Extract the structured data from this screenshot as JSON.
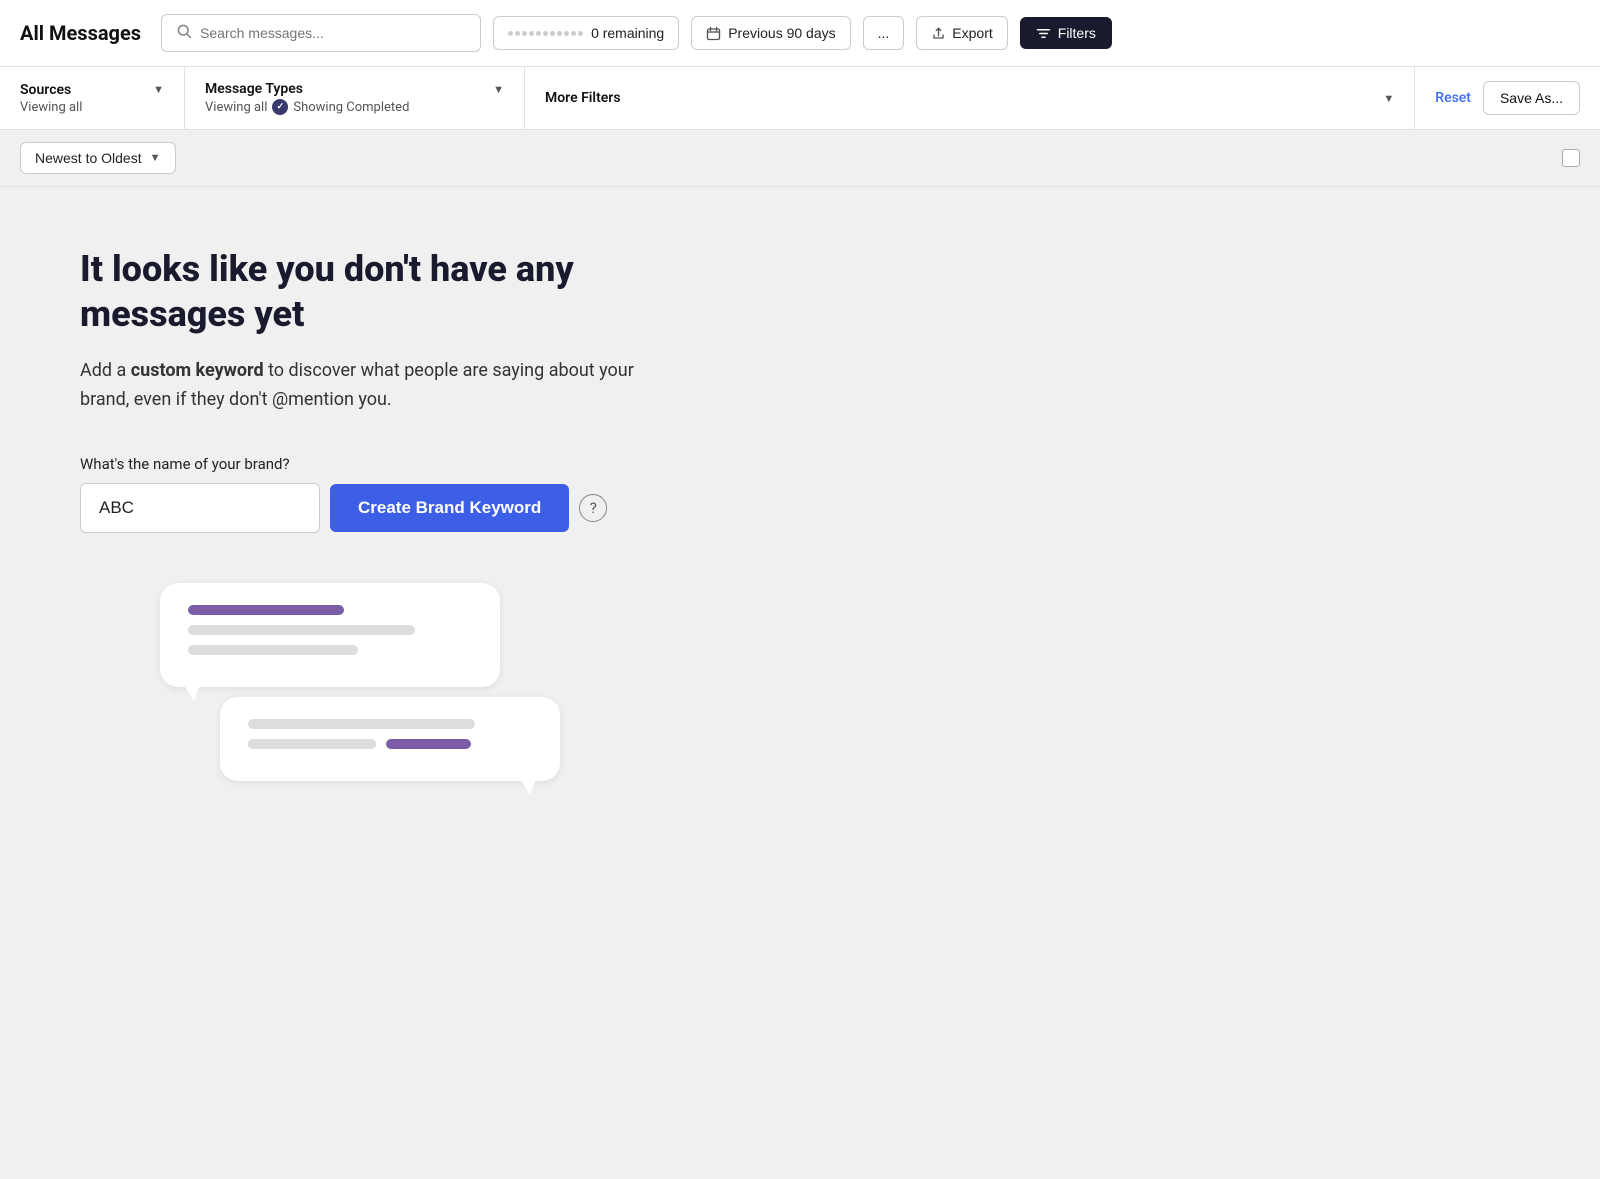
{
  "header": {
    "title": "All Messages",
    "search_placeholder": "Search messages...",
    "remaining_label": "0 remaining",
    "date_range_label": "Previous 90 days",
    "more_label": "...",
    "export_label": "Export",
    "filters_label": "Filters"
  },
  "filter_bar": {
    "sources_label": "Sources",
    "sources_sublabel": "Viewing all",
    "message_types_label": "Message Types",
    "message_types_sublabel": "Viewing all",
    "message_types_badge": "Showing Completed",
    "more_filters_label": "More Filters",
    "reset_label": "Reset",
    "save_as_label": "Save As..."
  },
  "sort_bar": {
    "sort_label": "Newest to Oldest"
  },
  "main": {
    "empty_heading": "It looks like you don't have any messages yet",
    "empty_subtext_prefix": "Add a ",
    "empty_subtext_bold": "custom keyword",
    "empty_subtext_suffix": " to discover what people are saying about your brand, even if they don't @mention you.",
    "brand_form_label": "What's the name of your brand?",
    "brand_input_value": "ABC",
    "brand_input_placeholder": "ABC",
    "create_keyword_label": "Create Brand Keyword",
    "help_icon_label": "?"
  }
}
